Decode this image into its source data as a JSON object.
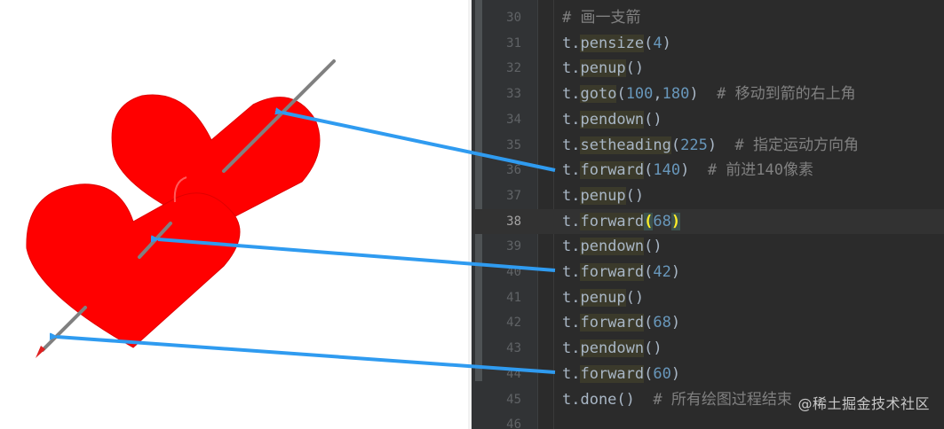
{
  "editor": {
    "lines": [
      {
        "num": "30",
        "tokens": [
          {
            "t": "# 画一支箭",
            "c": "cmt"
          }
        ]
      },
      {
        "num": "31",
        "tokens": [
          {
            "t": "t.",
            "c": ""
          },
          {
            "t": "pensize",
            "c": "hl"
          },
          {
            "t": "(",
            "c": ""
          },
          {
            "t": "4",
            "c": "num"
          },
          {
            "t": ")",
            "c": ""
          }
        ]
      },
      {
        "num": "32",
        "tokens": [
          {
            "t": "t.",
            "c": ""
          },
          {
            "t": "penup",
            "c": "hl"
          },
          {
            "t": "()",
            "c": ""
          }
        ]
      },
      {
        "num": "33",
        "tokens": [
          {
            "t": "t.",
            "c": ""
          },
          {
            "t": "goto",
            "c": "hl"
          },
          {
            "t": "(",
            "c": ""
          },
          {
            "t": "100",
            "c": "num"
          },
          {
            "t": ",",
            "c": ""
          },
          {
            "t": "180",
            "c": "num"
          },
          {
            "t": ")  ",
            "c": ""
          },
          {
            "t": "# 移动到箭的右上角",
            "c": "cmt"
          }
        ]
      },
      {
        "num": "34",
        "tokens": [
          {
            "t": "t.",
            "c": ""
          },
          {
            "t": "pendown",
            "c": "hl"
          },
          {
            "t": "()",
            "c": ""
          }
        ]
      },
      {
        "num": "35",
        "tokens": [
          {
            "t": "t.",
            "c": ""
          },
          {
            "t": "setheading",
            "c": "hl"
          },
          {
            "t": "(",
            "c": ""
          },
          {
            "t": "225",
            "c": "num"
          },
          {
            "t": ")  ",
            "c": ""
          },
          {
            "t": "# 指定运动方向角",
            "c": "cmt"
          }
        ]
      },
      {
        "num": "36",
        "tokens": [
          {
            "t": "t.",
            "c": ""
          },
          {
            "t": "forward",
            "c": "hl"
          },
          {
            "t": "(",
            "c": ""
          },
          {
            "t": "140",
            "c": "num"
          },
          {
            "t": ")  ",
            "c": ""
          },
          {
            "t": "# 前进140像素",
            "c": "cmt"
          }
        ]
      },
      {
        "num": "37",
        "tokens": [
          {
            "t": "t.",
            "c": ""
          },
          {
            "t": "penup",
            "c": "hl"
          },
          {
            "t": "()",
            "c": ""
          }
        ]
      },
      {
        "num": "38",
        "current": true,
        "tokens": [
          {
            "t": "t.",
            "c": ""
          },
          {
            "t": "forward",
            "c": "hl"
          },
          {
            "t": "(",
            "c": "brace"
          },
          {
            "t": "68",
            "c": "num"
          },
          {
            "t": ")",
            "c": "brace"
          }
        ]
      },
      {
        "num": "39",
        "tokens": [
          {
            "t": "t.",
            "c": ""
          },
          {
            "t": "pendown",
            "c": "hl"
          },
          {
            "t": "()",
            "c": ""
          }
        ]
      },
      {
        "num": "40",
        "tokens": [
          {
            "t": "t.",
            "c": ""
          },
          {
            "t": "forward",
            "c": "hl"
          },
          {
            "t": "(",
            "c": ""
          },
          {
            "t": "42",
            "c": "num"
          },
          {
            "t": ")",
            "c": ""
          }
        ]
      },
      {
        "num": "41",
        "tokens": [
          {
            "t": "t.",
            "c": ""
          },
          {
            "t": "penup",
            "c": "hl"
          },
          {
            "t": "()",
            "c": ""
          }
        ]
      },
      {
        "num": "42",
        "tokens": [
          {
            "t": "t.",
            "c": ""
          },
          {
            "t": "forward",
            "c": "hl"
          },
          {
            "t": "(",
            "c": ""
          },
          {
            "t": "68",
            "c": "num"
          },
          {
            "t": ")",
            "c": ""
          }
        ]
      },
      {
        "num": "43",
        "tokens": [
          {
            "t": "t.",
            "c": ""
          },
          {
            "t": "pendown",
            "c": "hl"
          },
          {
            "t": "()",
            "c": ""
          }
        ]
      },
      {
        "num": "44",
        "tokens": [
          {
            "t": "t.",
            "c": ""
          },
          {
            "t": "forward",
            "c": "hl"
          },
          {
            "t": "(",
            "c": ""
          },
          {
            "t": "60",
            "c": "num"
          },
          {
            "t": ")",
            "c": ""
          }
        ]
      },
      {
        "num": "45",
        "tokens": [
          {
            "t": "t.done()  ",
            "c": ""
          },
          {
            "t": "# 所有绘图过程结束",
            "c": "cmt"
          }
        ]
      },
      {
        "num": "46",
        "tokens": []
      }
    ]
  },
  "watermark": "@稀土掘金技术社区",
  "colors": {
    "heart": "#ff0000",
    "arrow_shaft": "#808080",
    "annotation_arrow": "#2f9bf0",
    "editor_bg": "#2b2b2b",
    "gutter_bg": "#313335",
    "keyword_text": "#a9b7c6",
    "number": "#6897bb",
    "comment": "#808080"
  }
}
